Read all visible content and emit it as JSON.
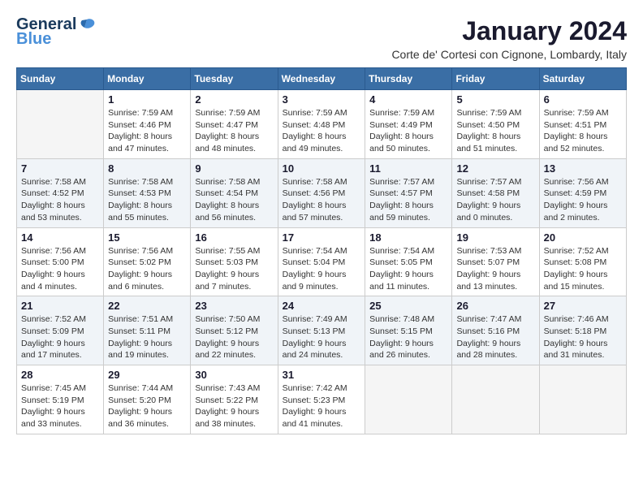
{
  "logo": {
    "line1": "General",
    "line2": "Blue"
  },
  "title": "January 2024",
  "subtitle": "Corte de' Cortesi con Cignone, Lombardy, Italy",
  "days_of_week": [
    "Sunday",
    "Monday",
    "Tuesday",
    "Wednesday",
    "Thursday",
    "Friday",
    "Saturday"
  ],
  "weeks": [
    [
      {
        "num": "",
        "info": ""
      },
      {
        "num": "1",
        "info": "Sunrise: 7:59 AM\nSunset: 4:46 PM\nDaylight: 8 hours\nand 47 minutes."
      },
      {
        "num": "2",
        "info": "Sunrise: 7:59 AM\nSunset: 4:47 PM\nDaylight: 8 hours\nand 48 minutes."
      },
      {
        "num": "3",
        "info": "Sunrise: 7:59 AM\nSunset: 4:48 PM\nDaylight: 8 hours\nand 49 minutes."
      },
      {
        "num": "4",
        "info": "Sunrise: 7:59 AM\nSunset: 4:49 PM\nDaylight: 8 hours\nand 50 minutes."
      },
      {
        "num": "5",
        "info": "Sunrise: 7:59 AM\nSunset: 4:50 PM\nDaylight: 8 hours\nand 51 minutes."
      },
      {
        "num": "6",
        "info": "Sunrise: 7:59 AM\nSunset: 4:51 PM\nDaylight: 8 hours\nand 52 minutes."
      }
    ],
    [
      {
        "num": "7",
        "info": "Sunrise: 7:58 AM\nSunset: 4:52 PM\nDaylight: 8 hours\nand 53 minutes."
      },
      {
        "num": "8",
        "info": "Sunrise: 7:58 AM\nSunset: 4:53 PM\nDaylight: 8 hours\nand 55 minutes."
      },
      {
        "num": "9",
        "info": "Sunrise: 7:58 AM\nSunset: 4:54 PM\nDaylight: 8 hours\nand 56 minutes."
      },
      {
        "num": "10",
        "info": "Sunrise: 7:58 AM\nSunset: 4:56 PM\nDaylight: 8 hours\nand 57 minutes."
      },
      {
        "num": "11",
        "info": "Sunrise: 7:57 AM\nSunset: 4:57 PM\nDaylight: 8 hours\nand 59 minutes."
      },
      {
        "num": "12",
        "info": "Sunrise: 7:57 AM\nSunset: 4:58 PM\nDaylight: 9 hours\nand 0 minutes."
      },
      {
        "num": "13",
        "info": "Sunrise: 7:56 AM\nSunset: 4:59 PM\nDaylight: 9 hours\nand 2 minutes."
      }
    ],
    [
      {
        "num": "14",
        "info": "Sunrise: 7:56 AM\nSunset: 5:00 PM\nDaylight: 9 hours\nand 4 minutes."
      },
      {
        "num": "15",
        "info": "Sunrise: 7:56 AM\nSunset: 5:02 PM\nDaylight: 9 hours\nand 6 minutes."
      },
      {
        "num": "16",
        "info": "Sunrise: 7:55 AM\nSunset: 5:03 PM\nDaylight: 9 hours\nand 7 minutes."
      },
      {
        "num": "17",
        "info": "Sunrise: 7:54 AM\nSunset: 5:04 PM\nDaylight: 9 hours\nand 9 minutes."
      },
      {
        "num": "18",
        "info": "Sunrise: 7:54 AM\nSunset: 5:05 PM\nDaylight: 9 hours\nand 11 minutes."
      },
      {
        "num": "19",
        "info": "Sunrise: 7:53 AM\nSunset: 5:07 PM\nDaylight: 9 hours\nand 13 minutes."
      },
      {
        "num": "20",
        "info": "Sunrise: 7:52 AM\nSunset: 5:08 PM\nDaylight: 9 hours\nand 15 minutes."
      }
    ],
    [
      {
        "num": "21",
        "info": "Sunrise: 7:52 AM\nSunset: 5:09 PM\nDaylight: 9 hours\nand 17 minutes."
      },
      {
        "num": "22",
        "info": "Sunrise: 7:51 AM\nSunset: 5:11 PM\nDaylight: 9 hours\nand 19 minutes."
      },
      {
        "num": "23",
        "info": "Sunrise: 7:50 AM\nSunset: 5:12 PM\nDaylight: 9 hours\nand 22 minutes."
      },
      {
        "num": "24",
        "info": "Sunrise: 7:49 AM\nSunset: 5:13 PM\nDaylight: 9 hours\nand 24 minutes."
      },
      {
        "num": "25",
        "info": "Sunrise: 7:48 AM\nSunset: 5:15 PM\nDaylight: 9 hours\nand 26 minutes."
      },
      {
        "num": "26",
        "info": "Sunrise: 7:47 AM\nSunset: 5:16 PM\nDaylight: 9 hours\nand 28 minutes."
      },
      {
        "num": "27",
        "info": "Sunrise: 7:46 AM\nSunset: 5:18 PM\nDaylight: 9 hours\nand 31 minutes."
      }
    ],
    [
      {
        "num": "28",
        "info": "Sunrise: 7:45 AM\nSunset: 5:19 PM\nDaylight: 9 hours\nand 33 minutes."
      },
      {
        "num": "29",
        "info": "Sunrise: 7:44 AM\nSunset: 5:20 PM\nDaylight: 9 hours\nand 36 minutes."
      },
      {
        "num": "30",
        "info": "Sunrise: 7:43 AM\nSunset: 5:22 PM\nDaylight: 9 hours\nand 38 minutes."
      },
      {
        "num": "31",
        "info": "Sunrise: 7:42 AM\nSunset: 5:23 PM\nDaylight: 9 hours\nand 41 minutes."
      },
      {
        "num": "",
        "info": ""
      },
      {
        "num": "",
        "info": ""
      },
      {
        "num": "",
        "info": ""
      }
    ]
  ]
}
